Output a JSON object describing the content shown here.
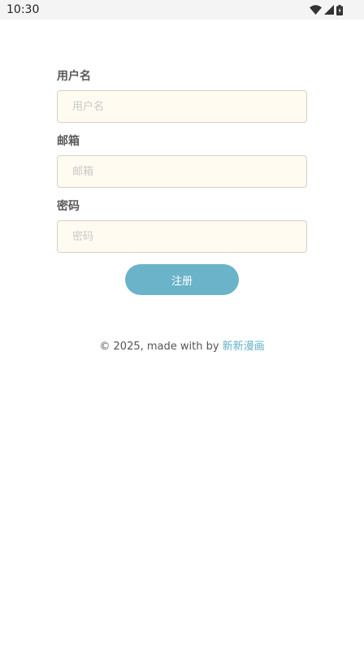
{
  "status_bar": {
    "time": "10:30",
    "icons": [
      "wifi-icon",
      "signal-icon",
      "battery-icon"
    ]
  },
  "form": {
    "username": {
      "label": "用户名",
      "placeholder": "用户名",
      "value": ""
    },
    "email": {
      "label": "邮箱",
      "placeholder": "邮箱",
      "value": ""
    },
    "password": {
      "label": "密码",
      "placeholder": "密码",
      "value": ""
    },
    "submit_label": "注册"
  },
  "footer": {
    "text": "© 2025, made with by",
    "link_text": "新新漫画"
  },
  "colors": {
    "accent": "#6bb3c8",
    "link": "#5fb0c4",
    "input_background": "#fffbf1",
    "input_border": "#d9d0bf",
    "label": "#5a5a5a"
  }
}
